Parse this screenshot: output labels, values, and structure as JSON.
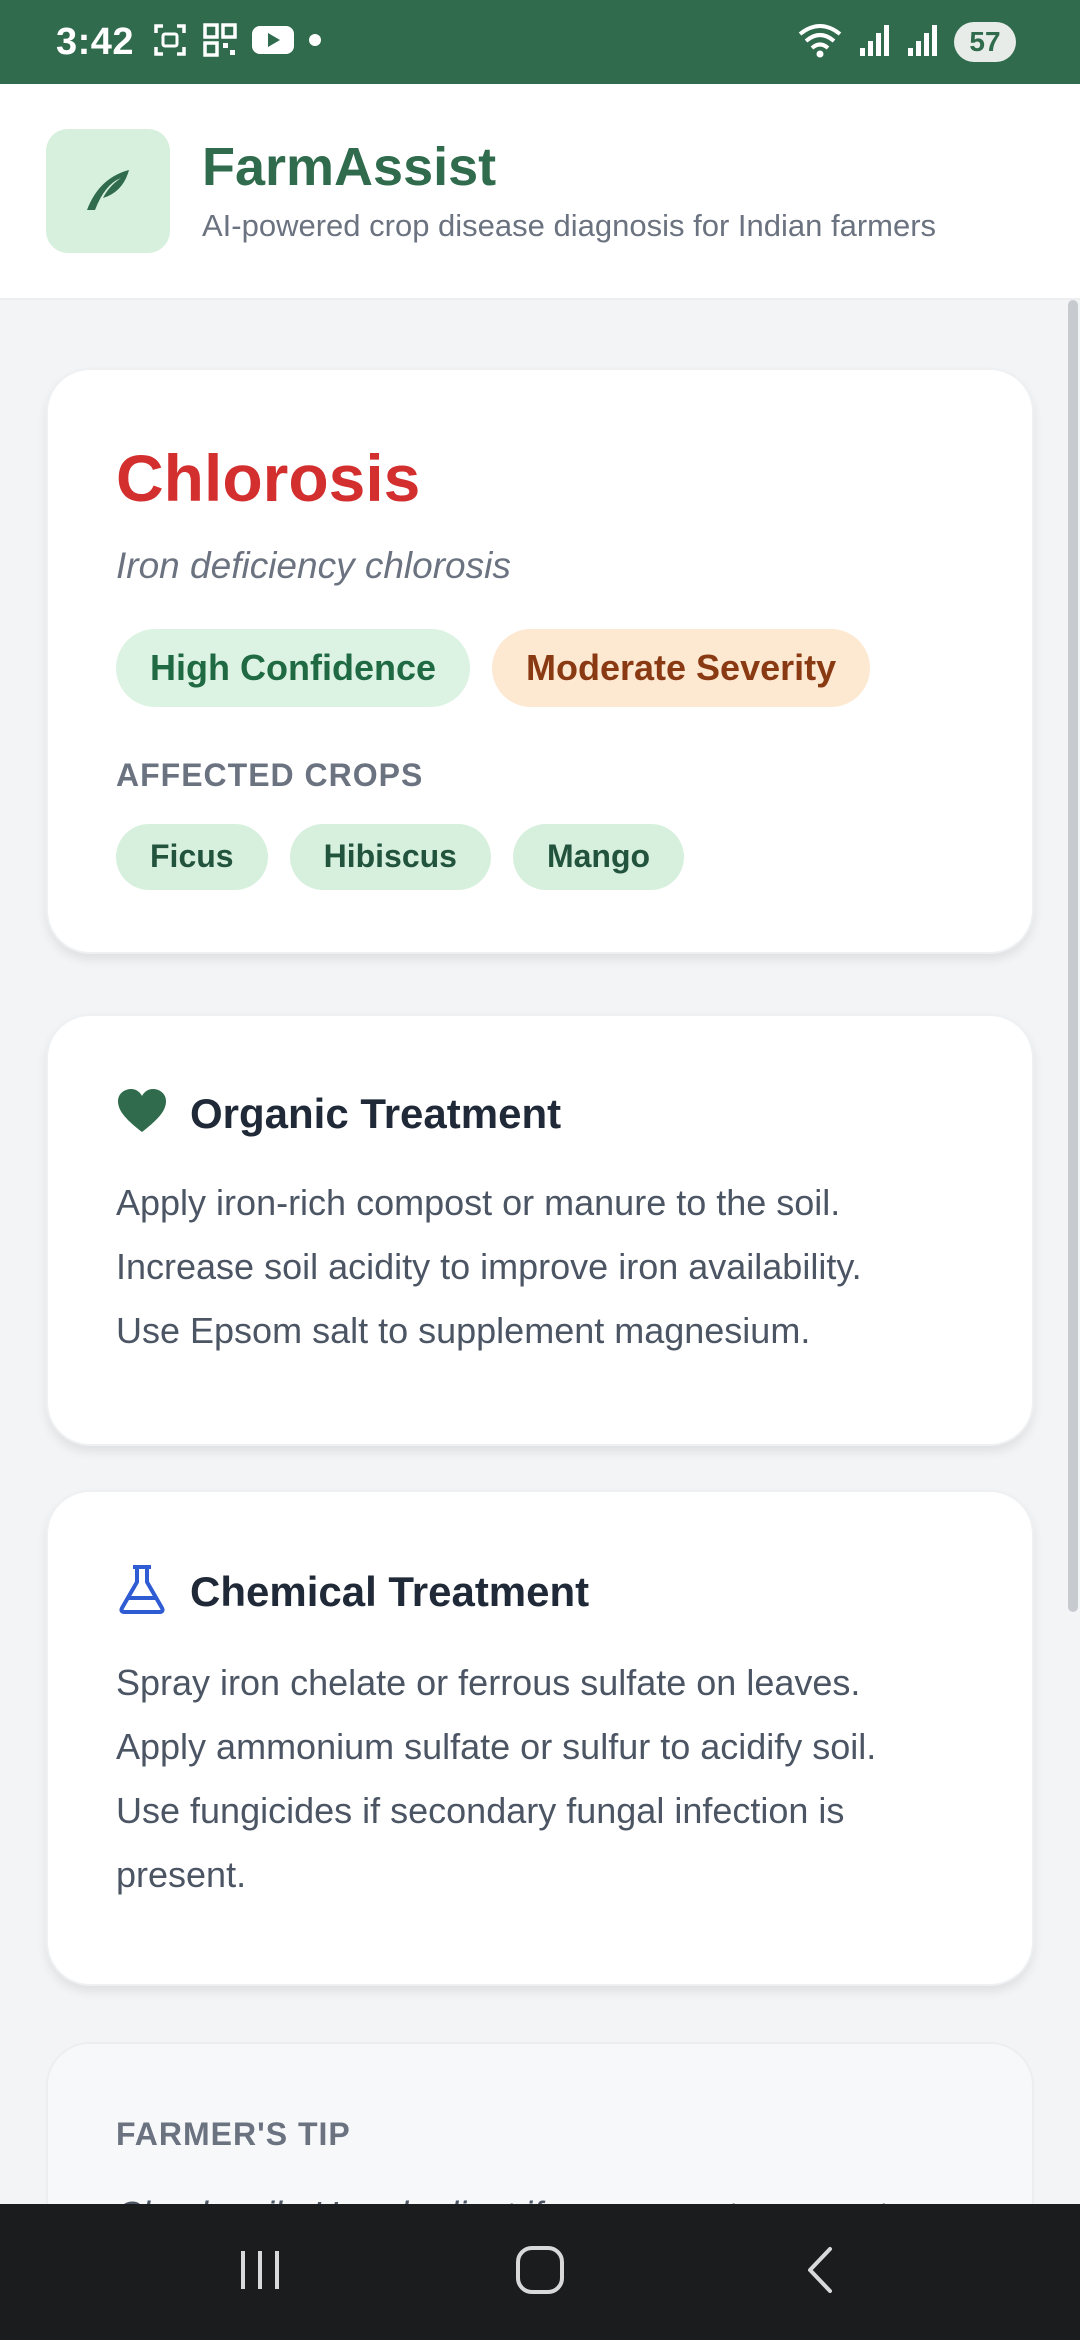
{
  "status_bar": {
    "time": "3:42",
    "battery": "57",
    "icons_left": [
      "screenshot-icon",
      "qr-scan-icon",
      "youtube-icon",
      "dot-icon"
    ],
    "icons_right": [
      "wifi-icon",
      "signal-icon",
      "signal-icon",
      "battery-icon"
    ]
  },
  "header": {
    "app_name": "FarmAssist",
    "subtitle": "AI-powered crop disease diagnosis for Indian farmers",
    "logo_icon": "leaf-icon"
  },
  "diagnosis": {
    "name": "Chlorosis",
    "scientific": "Iron deficiency chlorosis",
    "confidence": "High Confidence",
    "severity": "Moderate Severity",
    "crops_label": "AFFECTED CROPS",
    "crops": [
      "Ficus",
      "Hibiscus",
      "Mango"
    ]
  },
  "organic": {
    "title": "Organic Treatment",
    "icon": "heart-icon",
    "lines": [
      "Apply iron-rich compost or manure to the soil.",
      "Increase soil acidity to improve iron availability.",
      "Use Epsom salt to supplement magnesium."
    ]
  },
  "chemical": {
    "title": "Chemical Treatment",
    "icon": "flask-icon",
    "lines": [
      "Spray iron chelate or ferrous sulfate on leaves.",
      "Apply ammonium sulfate or sulfur to acidify soil.",
      "Use fungicides if secondary fungal infection is present."
    ]
  },
  "tip": {
    "label": "FARMER'S TIP",
    "text": "Check soil pH and adjust if necessary to prevent"
  },
  "colors": {
    "brand_green": "#2f6b4c",
    "disease_red": "#d32f2f",
    "confidence_bg": "#dcf3e4",
    "severity_bg": "#fde8d1",
    "chemical_blue": "#2f5bd3"
  }
}
